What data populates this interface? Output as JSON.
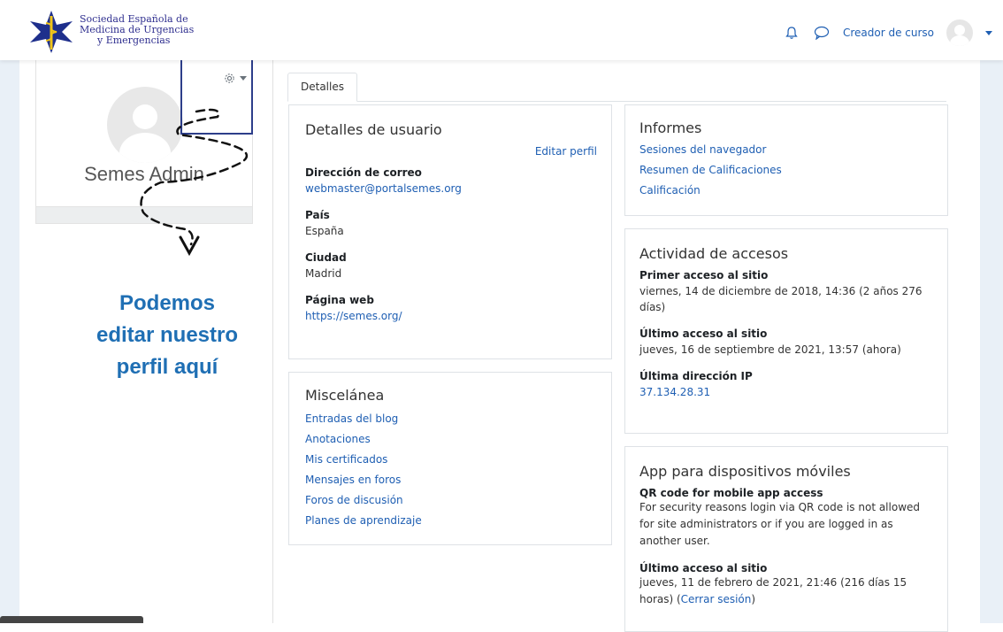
{
  "header": {
    "logo_lines": [
      "Sociedad Española de",
      "Medicina de Urgencias",
      "y Emergencias"
    ],
    "user_role": "Creador de curso"
  },
  "profile": {
    "name": "Semes Admin"
  },
  "annotation": {
    "callout_lines": [
      "Podemos",
      "editar nuestro",
      "perfil aquí"
    ]
  },
  "tabs": [
    {
      "label": "Detalles"
    }
  ],
  "user_details": {
    "title": "Detalles de usuario",
    "edit_link": "Editar perfil",
    "email_label": "Dirección de correo",
    "email": "webmaster@portalsemes.org",
    "country_label": "País",
    "country": "España",
    "city_label": "Ciudad",
    "city": "Madrid",
    "web_label": "Página web",
    "web": "https://semes.org/"
  },
  "misc": {
    "title": "Miscelánea",
    "links": [
      "Entradas del blog",
      "Anotaciones",
      "Mis certificados",
      "Mensajes en foros",
      "Foros de discusión",
      "Planes de aprendizaje"
    ]
  },
  "reports": {
    "title": "Informes",
    "links": [
      "Sesiones del navegador",
      "Resumen de Calificaciones",
      "Calificación"
    ]
  },
  "access": {
    "title": "Actividad de accesos",
    "first_label": "Primer acceso al sitio",
    "first_value": "viernes, 14 de diciembre de 2018, 14:36  (2 años 276 días)",
    "last_label": "Último acceso al sitio",
    "last_value": "jueves, 16 de septiembre de 2021, 13:57  (ahora)",
    "ip_label": "Última dirección IP",
    "ip_value": "37.134.28.31"
  },
  "mobile": {
    "title": "App para dispositivos móviles",
    "qr_label": "QR code for mobile app access",
    "qr_text": "For security reasons login via QR code is not allowed for site administrators or if you are logged in as another user.",
    "last_label": "Último acceso al sitio",
    "last_value": "jueves, 11 de febrero de 2021, 21:46  (216 días 15 horas)",
    "logout_link": "Cerrar sesión"
  }
}
